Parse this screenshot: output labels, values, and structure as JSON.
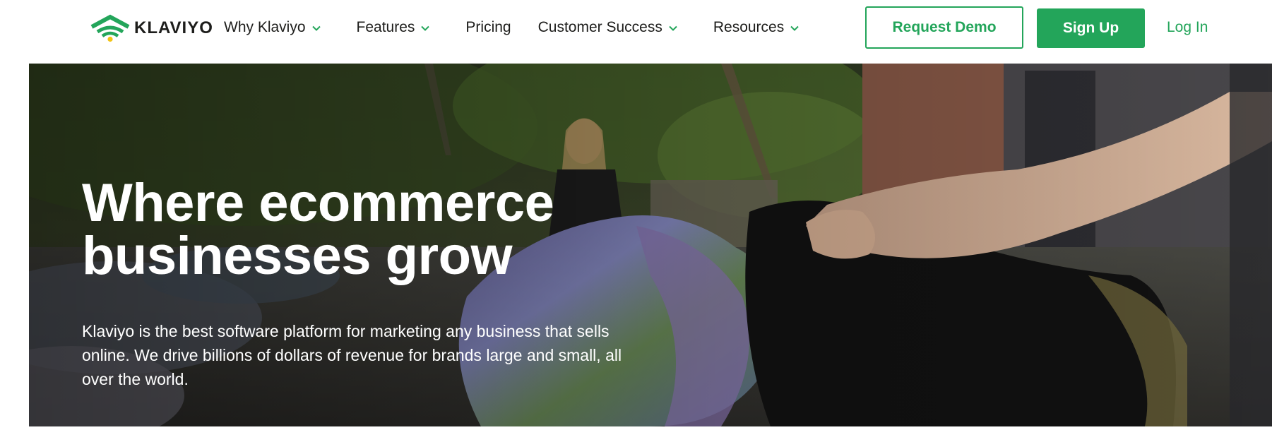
{
  "brand": {
    "name": "KLAVIYO",
    "accent_color": "#23a55a"
  },
  "nav": {
    "items": [
      {
        "label": "Why Klaviyo",
        "has_dropdown": true
      },
      {
        "label": "Features",
        "has_dropdown": true
      },
      {
        "label": "Pricing",
        "has_dropdown": false
      },
      {
        "label": "Customer Success",
        "has_dropdown": true
      },
      {
        "label": "Resources",
        "has_dropdown": true
      }
    ],
    "dropdown_icon": "chevron-down-icon"
  },
  "actions": {
    "request_demo": "Request Demo",
    "sign_up": "Sign Up",
    "log_in": "Log In"
  },
  "hero": {
    "title_line1": "Where ecommerce",
    "title_line2": "businesses grow",
    "description": "Klaviyo is the best software platform for marketing any business that sells online. We drive billions of dollars of revenue for brands large and small, all over the world."
  }
}
